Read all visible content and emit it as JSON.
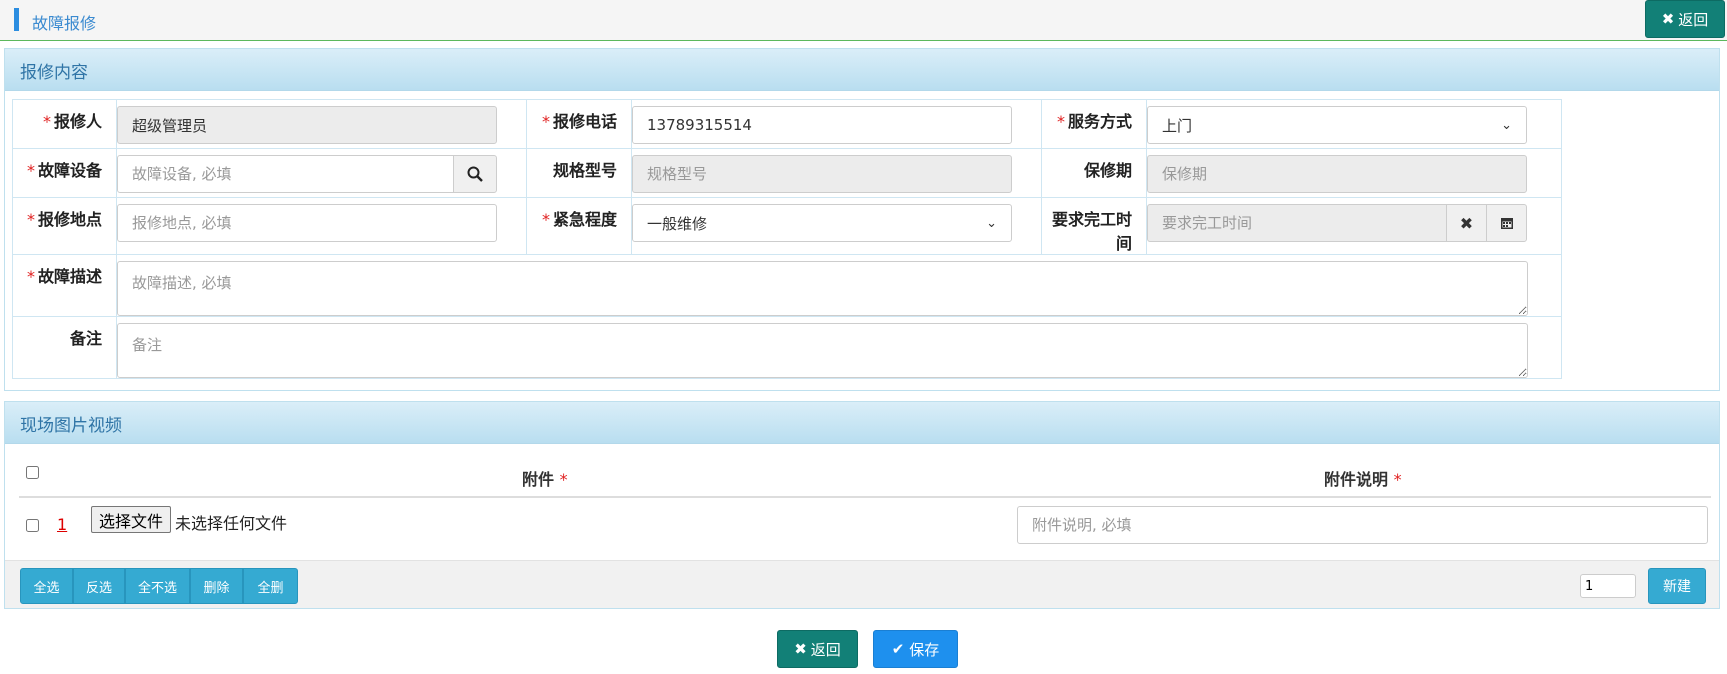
{
  "header": {
    "title": "故障报修",
    "back_label": "返回",
    "back_icon": "close-icon"
  },
  "repair_panel": {
    "title": "报修内容",
    "fields": {
      "reporter": {
        "label": "报修人",
        "value": "超级管理员",
        "required": true
      },
      "phone": {
        "label": "报修电话",
        "value": "13789315514",
        "required": true
      },
      "service": {
        "label": "服务方式",
        "value": "上门",
        "required": true
      },
      "device": {
        "label": "故障设备",
        "placeholder": "故障设备, 必填",
        "required": true
      },
      "spec": {
        "label": "规格型号",
        "placeholder": "规格型号"
      },
      "warranty": {
        "label": "保修期",
        "placeholder": "保修期"
      },
      "location": {
        "label": "报修地点",
        "placeholder": "报修地点, 必填",
        "required": true
      },
      "urgency": {
        "label": "紧急程度",
        "value": "一般维修",
        "required": true
      },
      "deadline": {
        "label": "要求完工时间",
        "placeholder": "要求完工时间"
      },
      "description": {
        "label": "故障描述",
        "placeholder": "故障描述, 必填",
        "required": true
      },
      "remark": {
        "label": "备注",
        "placeholder": "备注"
      }
    },
    "required_mark": "*"
  },
  "attachments_panel": {
    "title": "现场图片视频",
    "columns": {
      "attachment": "附件",
      "description": "附件说明"
    },
    "rows": [
      {
        "index": "1",
        "file_button": "选择文件",
        "file_status": "未选择任何文件",
        "desc_placeholder": "附件说明, 必填"
      }
    ],
    "toolbar": {
      "select_all": "全选",
      "invert": "反选",
      "select_none": "全不选",
      "delete": "删除",
      "delete_all": "全删"
    },
    "add_count": "1",
    "add_label": "新建"
  },
  "footer": {
    "back_label": "返回",
    "save_label": "保存"
  },
  "colors": {
    "accent": "#2b8de0",
    "teal": "#128077",
    "primary": "#1e90ee",
    "toolbar": "#35aad2",
    "required": "#e02020"
  }
}
